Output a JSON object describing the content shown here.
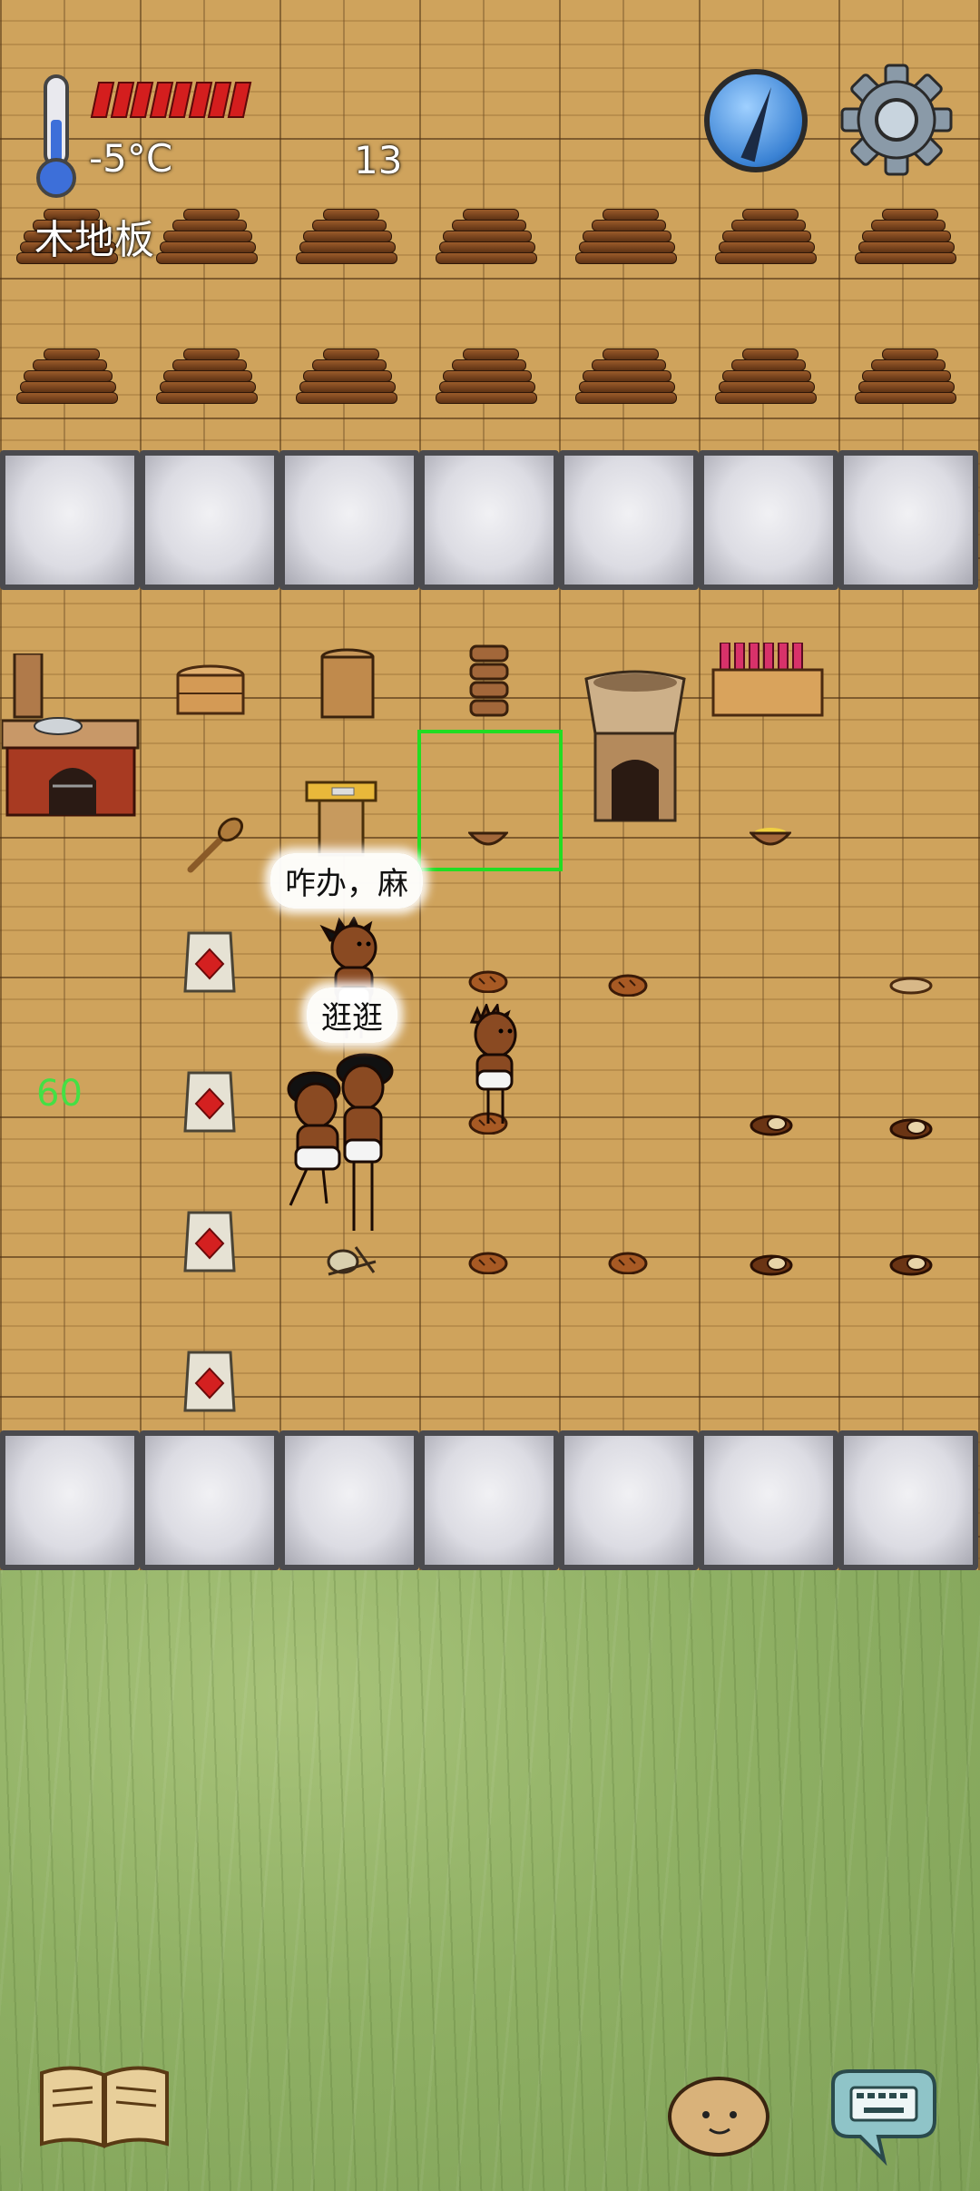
{
  "hud": {
    "temperature": "-5°C",
    "age": "13",
    "tile_name": "木地板",
    "food_pips": 8
  },
  "speech": {
    "bubble1": "咋办，麻",
    "bubble2": "逛逛"
  },
  "fps": "60",
  "colors": {
    "highlight": "#22dd22",
    "food": "#d41e1e",
    "thermometer": "#3d6fd9"
  },
  "icons": {
    "compass": "compass-icon",
    "settings": "gear-icon",
    "recipe_book": "book-icon",
    "emote": "face-icon",
    "chat": "keyboard-chat-icon"
  }
}
